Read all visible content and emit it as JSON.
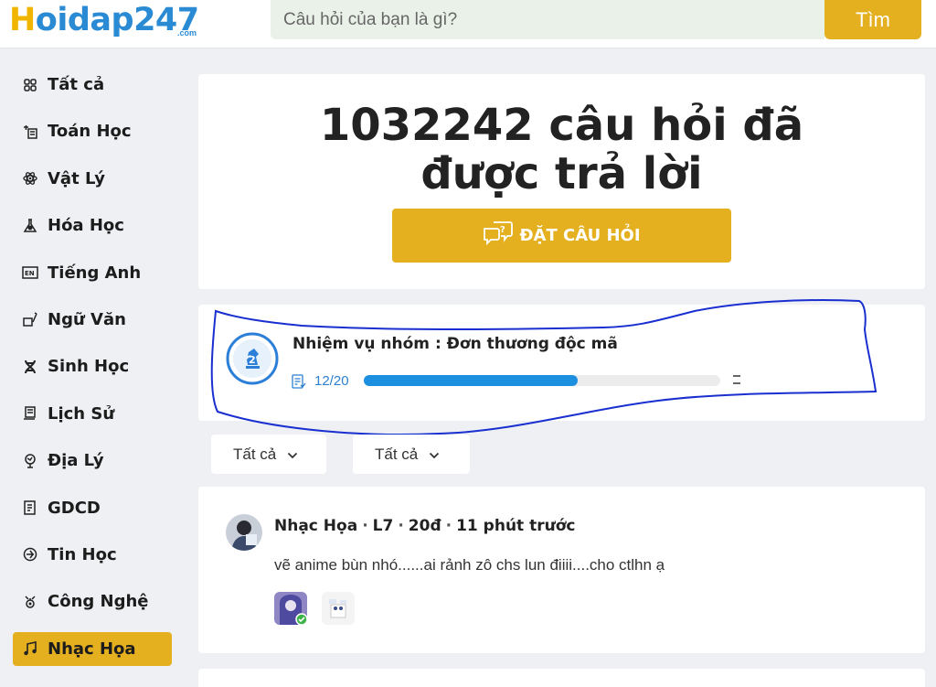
{
  "header": {
    "logo_text": "Hoidap247",
    "logo_letter": "H",
    "logo_rest": "oidap247",
    "logo_sub": ".com",
    "search_placeholder": "Câu hỏi của bạn là gì?",
    "search_button": "Tìm"
  },
  "sidebar": {
    "items": [
      {
        "label": "Tất cả",
        "icon": "grid-icon"
      },
      {
        "label": "Toán Học",
        "icon": "math-icon"
      },
      {
        "label": "Vật Lý",
        "icon": "atom-icon"
      },
      {
        "label": "Hóa Học",
        "icon": "flask-icon"
      },
      {
        "label": "Tiếng Anh",
        "icon": "en-icon"
      },
      {
        "label": "Ngữ Văn",
        "icon": "pen-book-icon"
      },
      {
        "label": "Sinh Học",
        "icon": "dna-icon"
      },
      {
        "label": "Lịch Sử",
        "icon": "scroll-icon"
      },
      {
        "label": "Địa Lý",
        "icon": "globe-icon"
      },
      {
        "label": "GDCD",
        "icon": "document-icon"
      },
      {
        "label": "Tin Học",
        "icon": "computer-icon"
      },
      {
        "label": "Công Nghệ",
        "icon": "gear-icon"
      },
      {
        "label": "Nhạc Họa",
        "icon": "music-icon",
        "active": true
      }
    ]
  },
  "hero": {
    "title_line1": "1032242 câu hỏi đã",
    "title_line2": "được trả lời",
    "ask_button": "ĐẶT CÂU HỎI"
  },
  "mission": {
    "title": "Nhiệm vụ nhóm : Đơn thương độc mã",
    "progress_text": "12/20",
    "progress_value": 0.6
  },
  "filters": [
    {
      "label": "Tất cả"
    },
    {
      "label": "Tất cả"
    }
  ],
  "post": {
    "author": "Nhạc Họa",
    "level": "L7",
    "points": "20đ",
    "time": "11 phút trước",
    "content": "vẽ anime bùn nhó......ai rảnh zô chs lun điiii....cho ctlhn ạ"
  },
  "colors": {
    "accent": "#e4b01f",
    "brand_blue": "#2a8bd4",
    "progress_blue": "#1d8fe0",
    "annotation_blue": "#1a2fd0"
  }
}
